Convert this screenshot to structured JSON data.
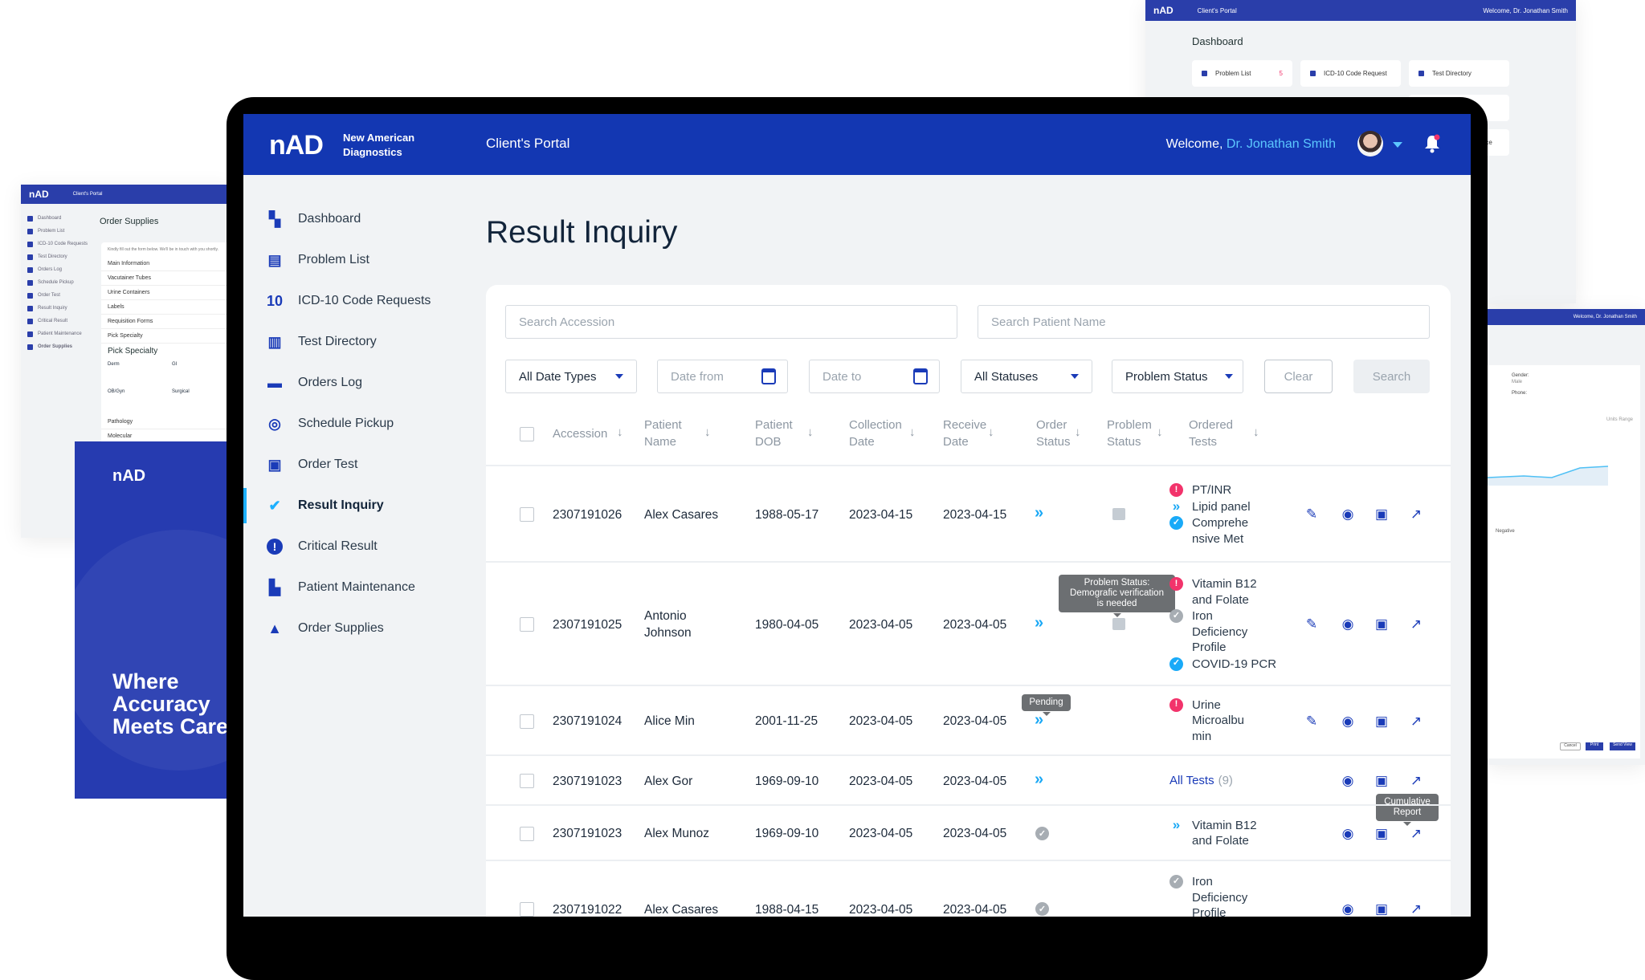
{
  "colors": {
    "brand": "#1337b2",
    "accent": "#1cb0ff",
    "critical": "#f2336b",
    "text": "#1d2a3a"
  },
  "brand": {
    "logo": "nAD",
    "name": "New American\nDiagnostics",
    "portal": "Client's Portal"
  },
  "header": {
    "welcome": "Welcome,",
    "user": "Dr. Jonathan Smith"
  },
  "sidebar": {
    "items": [
      {
        "label": "Dashboard",
        "icon": "dashboard-icon"
      },
      {
        "label": "Problem List",
        "icon": "problem-list-icon"
      },
      {
        "label": "ICD-10 Code Requests",
        "icon": "icd10-icon"
      },
      {
        "label": "Test Directory",
        "icon": "test-tubes-icon"
      },
      {
        "label": "Orders Log",
        "icon": "orders-log-icon"
      },
      {
        "label": "Schedule Pickup",
        "icon": "steering-wheel-icon"
      },
      {
        "label": "Order Test",
        "icon": "clipboard-icon"
      },
      {
        "label": "Result Inquiry",
        "icon": "hand-check-icon",
        "active": true
      },
      {
        "label": "Critical Result",
        "icon": "alert-circle-icon"
      },
      {
        "label": "Patient Maintenance",
        "icon": "patient-file-icon"
      },
      {
        "label": "Order Supplies",
        "icon": "flask-icon"
      }
    ]
  },
  "main": {
    "title": "Result Inquiry",
    "search": {
      "accession_placeholder": "Search Accession",
      "patient_placeholder": "Search Patient Name"
    },
    "filters": {
      "date_type": "All Date Types",
      "date_from": "Date from",
      "date_to": "Date to",
      "status": "All Statuses",
      "problem_status": "Problem Status",
      "clear": "Clear",
      "search": "Search"
    },
    "columns": [
      "Accession",
      "Patient\nName",
      "Patient\nDOB",
      "Collection\nDate",
      "Receive\nDate",
      "Order\nStatus",
      "Problem\nStatus",
      "Ordered\nTests"
    ],
    "rows": [
      {
        "accession": "2307191026",
        "name": "Alex Casares",
        "dob": "1988-05-17",
        "collection": "2023-04-15",
        "receive": "2023-04-15",
        "order_status": "in-progress",
        "problem": true,
        "edit": true,
        "tests": [
          {
            "status": "critical",
            "name": "PT/INR"
          },
          {
            "status": "progress",
            "name": "Lipid panel"
          },
          {
            "status": "done",
            "name": "Comprehe\nnsive Met"
          }
        ]
      },
      {
        "accession": "2307191025",
        "name": "Antonio\nJohnson",
        "dob": "1980-04-05",
        "collection": "2023-04-05",
        "receive": "2023-04-05",
        "order_status": "in-progress",
        "problem": true,
        "edit": true,
        "tests": [
          {
            "status": "critical",
            "name": "Vitamin B12\nand Folate"
          },
          {
            "status": "pending",
            "name": "Iron\nDeficiency\nProfile"
          },
          {
            "status": "done",
            "name": "COVID-19 PCR"
          }
        ]
      },
      {
        "accession": "2307191024",
        "name": "Alice Min",
        "dob": "2001-11-25",
        "collection": "2023-04-05",
        "receive": "2023-04-05",
        "order_status": "in-progress",
        "problem": false,
        "edit": true,
        "tests": [
          {
            "status": "critical",
            "name": "Urine\nMicroalbu\nmin"
          }
        ]
      },
      {
        "accession": "2307191023",
        "name": "Alex Gor",
        "dob": "1969-09-10",
        "collection": "2023-04-05",
        "receive": "2023-04-05",
        "order_status": "in-progress",
        "problem": false,
        "edit": false,
        "all_tests": "All Tests",
        "all_tests_count": "(9)",
        "tests": []
      },
      {
        "accession": "2307191023",
        "name": "Alex Munoz",
        "dob": "1969-09-10",
        "collection": "2023-04-05",
        "receive": "2023-04-05",
        "order_status": "completed",
        "problem": false,
        "edit": false,
        "tests": [
          {
            "status": "progress",
            "name": "Vitamin B12\nand Folate"
          }
        ]
      },
      {
        "accession": "2307191022",
        "name": "Alex Casares",
        "dob": "1988-04-15",
        "collection": "2023-04-05",
        "receive": "2023-04-05",
        "order_status": "completed",
        "problem": false,
        "edit": false,
        "tests": [
          {
            "status": "pending",
            "name": "Iron\nDeficiency\nProfile"
          }
        ]
      }
    ],
    "tooltips": {
      "problem": "Problem Status:\nDemografic verification\nis needed",
      "pending": "Pending",
      "cumulative": "Cumulative\nReport"
    }
  },
  "mockups": {
    "dashboard": {
      "portal": "Client's Portal",
      "welcome": "Welcome, Dr. Jonathan Smith",
      "title": "Dashboard",
      "cards": [
        {
          "label": "Problem List",
          "badge": "5"
        },
        {
          "label": "ICD-10 Code Request"
        },
        {
          "label": "Test Directory"
        }
      ],
      "partial": "nance"
    },
    "order_supplies": {
      "portal": "Client's Portal",
      "title": "Order Supplies",
      "intro": "Kindly fill out the form below. We'll be in touch with you shortly.",
      "nav": [
        "Dashboard",
        "Problem List",
        "ICD-10 Code Requests",
        "Test Directory",
        "Orders Log",
        "Schedule Pickup",
        "Order Test",
        "Result Inquiry",
        "Critical Result",
        "Patient Maintenance",
        "Order Supplies"
      ],
      "sections": [
        "Main Information",
        "Vacutainer Tubes",
        "Urine Containers",
        "Labels",
        "Requisition Forms",
        "Pick Specialty"
      ],
      "specialty_title": "Pick Specialty",
      "specialties": [
        "Derm",
        "GI",
        "OB/Gyn",
        "Surgical"
      ],
      "more": [
        "Pathology",
        "Molecular"
      ]
    },
    "promo": {
      "logo": "nAD",
      "tagline": "Where\nAccuracy\nMeets Care"
    },
    "report": {
      "welcome": "Welcome, Dr. Jonathan Smith",
      "gender_label": "Gender:",
      "gender": "Male",
      "phone_label": "Phone:",
      "units_range": "Units Range",
      "result": "Negative",
      "buttons": [
        "Cancel",
        "Print",
        "Send View"
      ]
    }
  }
}
